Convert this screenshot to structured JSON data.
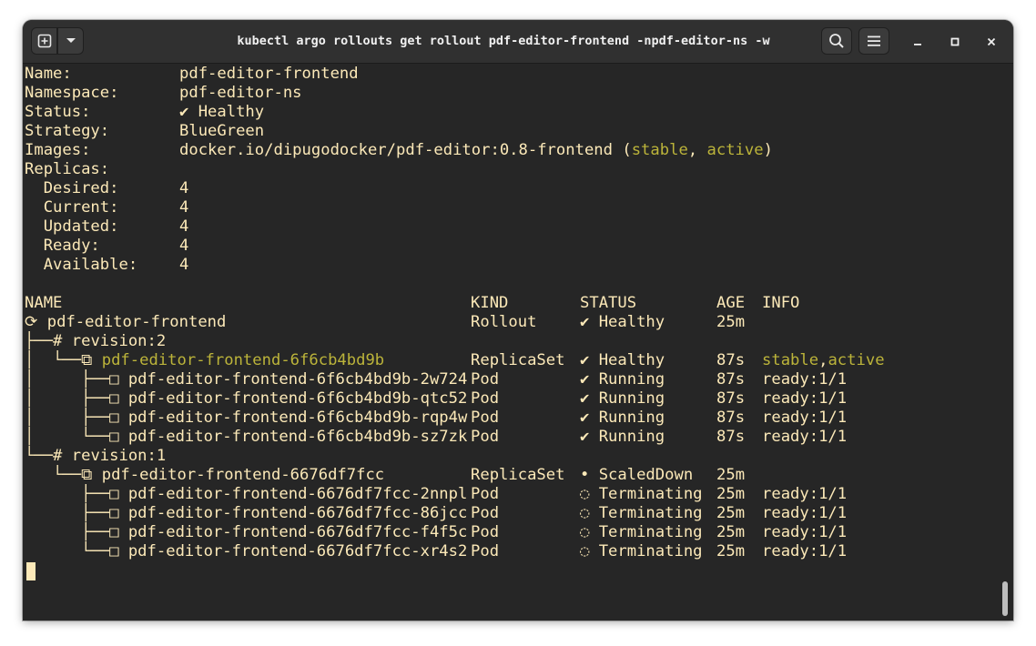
{
  "window": {
    "title": "kubectl argo rollouts get rollout pdf-editor-frontend -npdf-editor-ns -w",
    "buttons": {
      "new_tab_icon": "plus-in-box-icon",
      "dropdown_icon": "chevron-down-icon",
      "search_icon": "magnifier-icon",
      "menu_icon": "hamburger-icon",
      "minimize_icon": "minimize-icon",
      "maximize_icon": "maximize-icon",
      "close_icon": "close-icon"
    }
  },
  "colors": {
    "background": "#262626",
    "foreground": "#fce9b8",
    "accent_olive": "#bcb43a",
    "titlebar": "#303030"
  },
  "summary": {
    "name_label": "Name:",
    "name": "pdf-editor-frontend",
    "namespace_label": "Namespace:",
    "namespace": "pdf-editor-ns",
    "status_label": "Status:",
    "status": "✔ Healthy",
    "strategy_label": "Strategy:",
    "strategy": "BlueGreen",
    "images_label": "Images:",
    "image": "docker.io/dipugodocker/pdf-editor:0.8-frontend",
    "image_open": " (",
    "image_tag1": "stable",
    "image_sep": ", ",
    "image_tag2": "active",
    "image_close": ")",
    "replicas_label": "Replicas:",
    "desired_label": "  Desired:",
    "desired": "4",
    "current_label": "  Current:",
    "current": "4",
    "updated_label": "  Updated:",
    "updated": "4",
    "ready_label": "  Ready:",
    "ready": "4",
    "available_label": "  Available:",
    "available": "4"
  },
  "table": {
    "headers": {
      "name": "NAME",
      "kind": "KIND",
      "status": "STATUS",
      "age": "AGE",
      "info": "INFO"
    },
    "rows": [
      {
        "tree": "⟳ ",
        "name": "pdf-editor-frontend",
        "kind": "Rollout",
        "status": "✔ Healthy",
        "age": "25m",
        "info": ""
      },
      {
        "tree": "├──# ",
        "name": "revision:2",
        "kind": "",
        "status": "",
        "age": "",
        "info": ""
      },
      {
        "tree": "│  └──⧉ ",
        "name": "pdf-editor-frontend-6f6cb4bd9b",
        "kind": "ReplicaSet",
        "status": "✔ Healthy",
        "age": "87s",
        "info": "stable",
        "info_sep": ",",
        "info2": "active"
      },
      {
        "tree": "│     ├──□ ",
        "name": "pdf-editor-frontend-6f6cb4bd9b-2w724",
        "kind": "Pod",
        "status": "✔ Running",
        "age": "87s",
        "info": "ready:1/1"
      },
      {
        "tree": "│     ├──□ ",
        "name": "pdf-editor-frontend-6f6cb4bd9b-qtc52",
        "kind": "Pod",
        "status": "✔ Running",
        "age": "87s",
        "info": "ready:1/1"
      },
      {
        "tree": "│     ├──□ ",
        "name": "pdf-editor-frontend-6f6cb4bd9b-rqp4w",
        "kind": "Pod",
        "status": "✔ Running",
        "age": "87s",
        "info": "ready:1/1"
      },
      {
        "tree": "│     └──□ ",
        "name": "pdf-editor-frontend-6f6cb4bd9b-sz7zk",
        "kind": "Pod",
        "status": "✔ Running",
        "age": "87s",
        "info": "ready:1/1"
      },
      {
        "tree": "└──# ",
        "name": "revision:1",
        "kind": "",
        "status": "",
        "age": "",
        "info": ""
      },
      {
        "tree": "   └──⧉ ",
        "name": "pdf-editor-frontend-6676df7fcc",
        "kind": "ReplicaSet",
        "status": "• ScaledDown",
        "age": "25m",
        "info": ""
      },
      {
        "tree": "      ├──□ ",
        "name": "pdf-editor-frontend-6676df7fcc-2nnpl",
        "kind": "Pod",
        "status": "◌ Terminating",
        "age": "25m",
        "info": "ready:1/1"
      },
      {
        "tree": "      ├──□ ",
        "name": "pdf-editor-frontend-6676df7fcc-86jcc",
        "kind": "Pod",
        "status": "◌ Terminating",
        "age": "25m",
        "info": "ready:1/1"
      },
      {
        "tree": "      ├──□ ",
        "name": "pdf-editor-frontend-6676df7fcc-f4f5c",
        "kind": "Pod",
        "status": "◌ Terminating",
        "age": "25m",
        "info": "ready:1/1"
      },
      {
        "tree": "      └──□ ",
        "name": "pdf-editor-frontend-6676df7fcc-xr4s2",
        "kind": "Pod",
        "status": "◌ Terminating",
        "age": "25m",
        "info": "ready:1/1"
      }
    ]
  }
}
